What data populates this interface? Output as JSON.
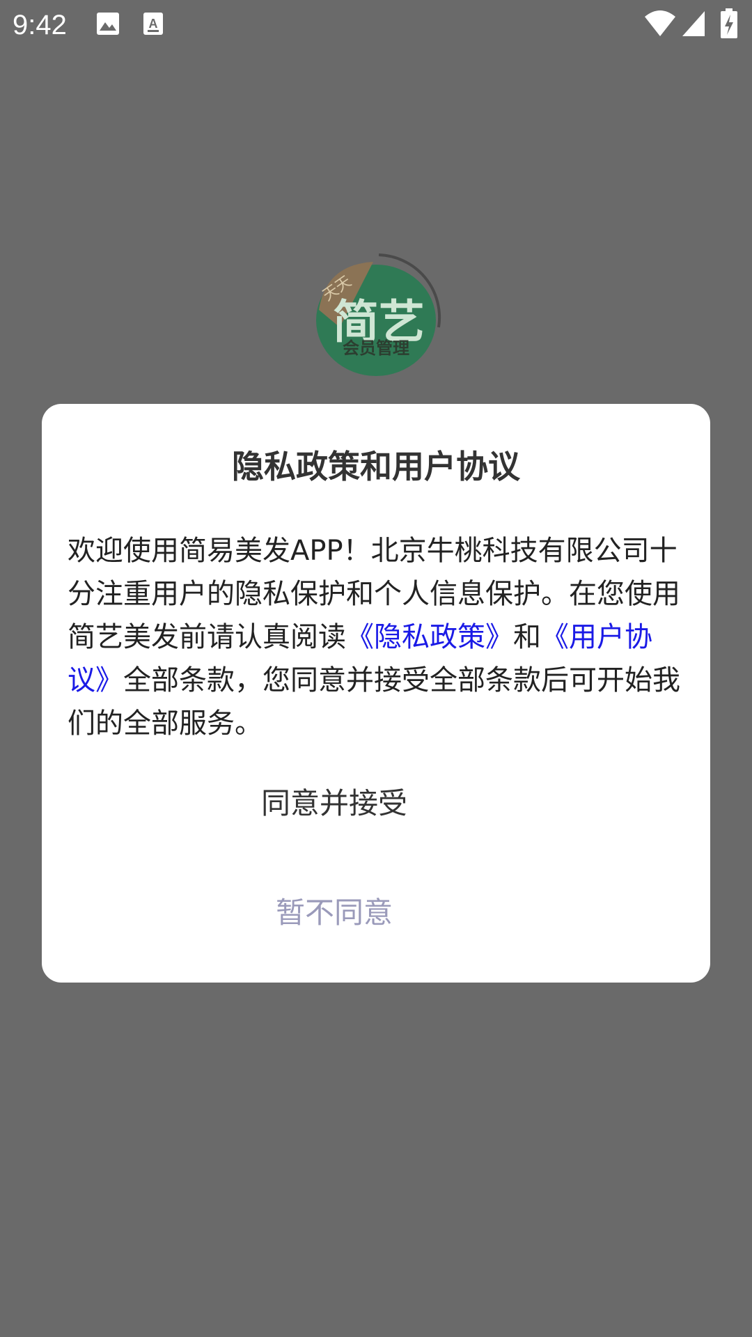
{
  "status_bar": {
    "time": "9:42",
    "icons": [
      "gallery-icon",
      "keyboard-a-icon",
      "wifi-icon",
      "signal-icon",
      "battery-charging-icon"
    ]
  },
  "logo": {
    "brand_main": "简艺",
    "brand_corner": "天天",
    "subtitle": "会员管理",
    "colors": {
      "green": "#2f7a55",
      "brown": "#8b7355"
    }
  },
  "dialog": {
    "title": "隐私政策和用户协议",
    "body": {
      "part1": "欢迎使用简易美发APP！北京牛桃科技有限公司十分注重用户的隐私保护和个人信息保护。在您使用简艺美发前请认真阅读",
      "link_privacy": "《隐私政策》",
      "and_text": "和",
      "link_agreement": "《用户协议》",
      "part2": "全部条款，您同意并接受全部条款后可开始我们的全部服务。"
    },
    "accept_label": "同意并接受",
    "decline_label": "暂不同意",
    "link_color": "#1a1ae6"
  }
}
